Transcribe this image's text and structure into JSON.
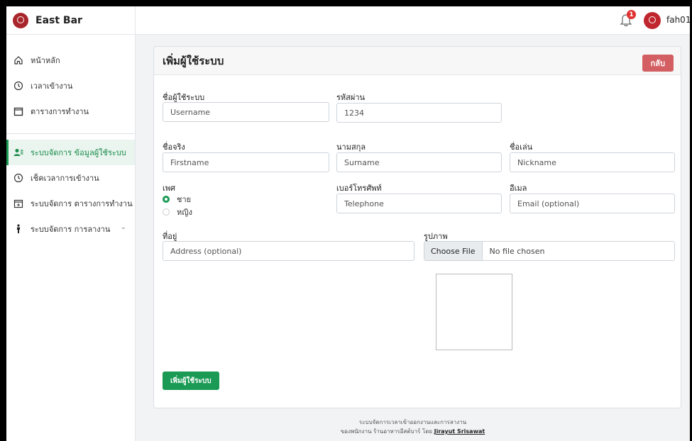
{
  "brand": {
    "name": "East Bar"
  },
  "sidebar": {
    "items": [
      {
        "label": "หน้าหลัก",
        "icon": "home-icon"
      },
      {
        "label": "เวลาเข้างาน",
        "icon": "clock-icon"
      },
      {
        "label": "ตารางการทำงาน",
        "icon": "calendar-icon"
      },
      {
        "label": "ระบบจัดการ ข้อมูลผู้ใช้ระบบ",
        "icon": "users-icon",
        "active": true
      },
      {
        "label": "เช็คเวลาการเข้างาน",
        "icon": "clock-icon"
      },
      {
        "label": "ระบบจัดการ ตารางการทำงาน",
        "icon": "calendar-plus-icon"
      },
      {
        "label": "ระบบจัดการ การลางาน",
        "icon": "person-walking-icon"
      }
    ]
  },
  "topbar": {
    "notification_count": "1",
    "username": "fah01"
  },
  "card": {
    "title": "เพิ่มผู้ใช้ระบบ",
    "back_label": "กลับ"
  },
  "form": {
    "username": {
      "label": "ชื่อผู้ใช้ระบบ",
      "placeholder": "Username"
    },
    "password": {
      "label": "รหัสผ่าน",
      "value": "1234"
    },
    "firstname": {
      "label": "ชื่อจริง",
      "placeholder": "Firstname"
    },
    "surname": {
      "label": "นามสกุล",
      "placeholder": "Surname"
    },
    "nickname": {
      "label": "ชื่อเล่น",
      "placeholder": "Nickname"
    },
    "gender": {
      "label": "เพศ",
      "options": [
        "ชาย",
        "หญิง"
      ],
      "selected": "ชาย"
    },
    "telephone": {
      "label": "เบอร์โทรศัพท์",
      "placeholder": "Telephone"
    },
    "email": {
      "label": "อีเมล",
      "placeholder": "Email (optional)"
    },
    "address": {
      "label": "ที่อยู่",
      "placeholder": "Address (optional)"
    },
    "image": {
      "label": "รูปภาพ",
      "button": "Choose File",
      "status": "No file chosen"
    },
    "submit_label": "เพิ่มผู้ใช้ระบบ"
  },
  "footer": {
    "line1": "ระบบจัดการเวลาเข้าออกงานและการลางาน",
    "line2_prefix": "ของพนักงาน ร้านอาหารอีสต์บาร์ โดย",
    "author": "Jirayut Srisawat"
  },
  "colors": {
    "accent": "#1a9a55",
    "danger": "#d35f62",
    "brand": "#a8262b"
  }
}
